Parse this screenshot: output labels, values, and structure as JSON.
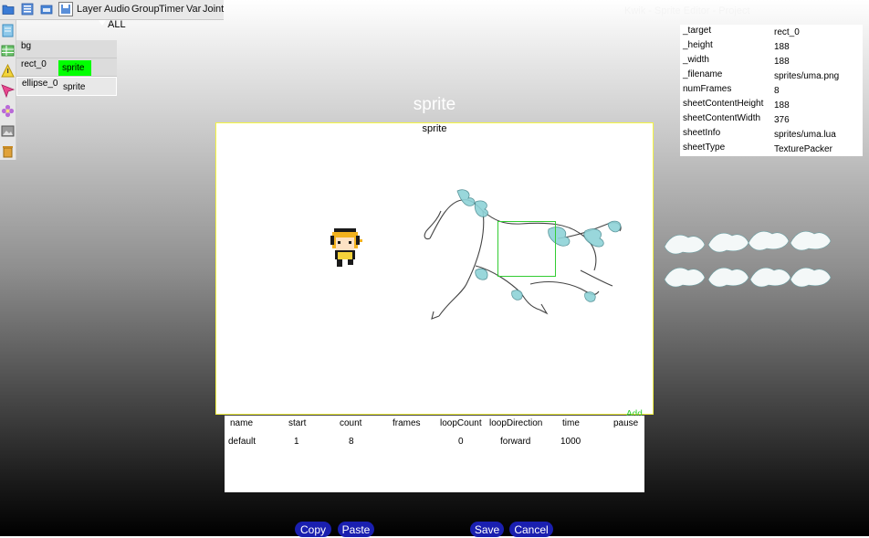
{
  "toolbar": {
    "menus": [
      "Layer",
      "Audio",
      "Group",
      "Timer",
      "Var",
      "Joint"
    ],
    "filter_label": "ALL",
    "title_faint": "Kwik - Sprite Editor - Project"
  },
  "left_tools": [
    "document-icon",
    "table-icon",
    "warning-icon",
    "pointer-icon",
    "flower-icon",
    "image-icon",
    "trash-icon"
  ],
  "layers": [
    {
      "name": "bg",
      "tag": ""
    },
    {
      "name": "rect_0",
      "tag": "sprite",
      "tag_color": "#00ff00"
    },
    {
      "name": "ellipse_0",
      "tag": "sprite",
      "tag_color": "#e8e8e8"
    }
  ],
  "canvas": {
    "title": "sprite",
    "label": "sprite"
  },
  "properties": [
    {
      "key": "_target",
      "value": "rect_0"
    },
    {
      "key": "_height",
      "value": "188"
    },
    {
      "key": "_width",
      "value": "188"
    },
    {
      "key": "_filename",
      "value": "sprites/uma.png"
    },
    {
      "key": "numFrames",
      "value": "8"
    },
    {
      "key": "sheetContentHeight",
      "value": "188"
    },
    {
      "key": "sheetContentWidth",
      "value": "376"
    },
    {
      "key": "sheetInfo",
      "value": "sprites/uma.lua"
    },
    {
      "key": "sheetType",
      "value": "TexturePacker"
    }
  ],
  "sequence": {
    "add_label": "Add",
    "headers": [
      "name",
      "start",
      "count",
      "frames",
      "loopCount",
      "loopDirection",
      "time",
      "pause"
    ],
    "rows": [
      {
        "name": "default",
        "start": "1",
        "count": "8",
        "frames": "",
        "loopCount": "0",
        "loopDirection": "forward",
        "time": "1000",
        "pause": ""
      }
    ]
  },
  "buttons": {
    "copy": "Copy",
    "paste": "Paste",
    "save": "Save",
    "cancel": "Cancel"
  },
  "colors": {
    "accent_button": "#1a1fb0",
    "selection_green": "#33cc33",
    "canvas_border": "#f5f542"
  }
}
